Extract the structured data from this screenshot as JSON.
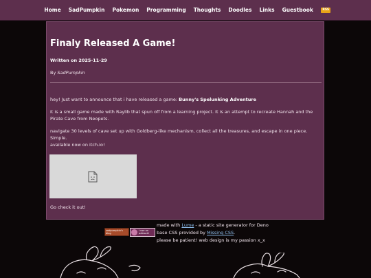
{
  "nav": {
    "items": [
      "Home",
      "SadPumpkin",
      "Pokemon",
      "Programming",
      "Thoughts",
      "Doodles",
      "Links",
      "Guestbook"
    ],
    "rss_label": "RSS"
  },
  "post": {
    "title": "Finaly Released A Game!",
    "written_prefix": "Written on ",
    "date": "2025-11-29",
    "by_prefix": "By ",
    "author": "SadPumpkin",
    "intro_text": "hey! Just want to announce that i have released a game: ",
    "game_name": "Bunny's Spelunking Adventure",
    "p2": "it is a small game made with Raylib that spun off from a learning project. It is an attempt to recreate Hannah and the Pirate Cave from Neopets.",
    "p3": "navigate 30 levels of cave set up with Goldberg-like mechanism, collect all the treasures, and escape in one piece. Simple.",
    "p4": "available now on itch.io!",
    "cta": "Go check it out!",
    "image_icon": "broken-image-icon"
  },
  "footer": {
    "line1_prefix": "made with ",
    "line1_link": "Lume",
    "line1_suffix": " - a static site generator for Deno",
    "line2_prefix": "base CSS provided by ",
    "line2_link": "Missing CSS",
    "line2_suffix": ".",
    "line3": "please be patient! web design is my passion x_x",
    "badge1_lines": [
      "sadpumpkin's",
      "blog"
    ],
    "badge2_lines": [
      "i use an",
      "adblock!"
    ]
  },
  "colors": {
    "nav_bg": "#5d2f4d",
    "panel_bg": "#5d2f4d",
    "page_bg": "#0c0708",
    "link": "#8fc0f0",
    "rss": "#e8a317"
  }
}
